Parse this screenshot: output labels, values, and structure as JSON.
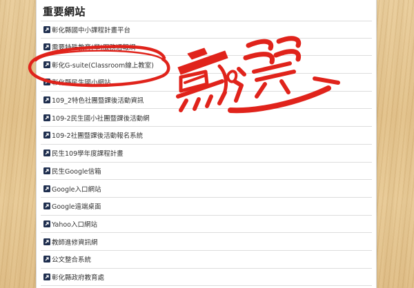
{
  "section": {
    "title": "重要網站"
  },
  "links": [
    {
      "label": "彰化縣國中小課程計畫平台"
    },
    {
      "label": "需要特殊教育(學)服務通報網"
    },
    {
      "label": "彰化G-suite(Classroom線上教室)"
    },
    {
      "label": "彰化縣民生國小網站"
    },
    {
      "label": "109_2特色社團暨課後活動資訊"
    },
    {
      "label": "109-2民生國小社團暨課後活動網"
    },
    {
      "label": "109-2社團暨課後活動報名系統"
    },
    {
      "label": "民生109學年度課程計畫"
    },
    {
      "label": "民生Google信箱"
    },
    {
      "label": "Google入口網站"
    },
    {
      "label": "Google遠端桌面"
    },
    {
      "label": "Yahoo入口網站"
    },
    {
      "label": "教師進修資訊網"
    },
    {
      "label": "公文整合系統"
    },
    {
      "label": "彰化縣政府教育處"
    }
  ],
  "annotation": {
    "text": "點選",
    "color": "#e0231b"
  },
  "icons": {
    "link_icon": "external-link-arrow-icon"
  }
}
